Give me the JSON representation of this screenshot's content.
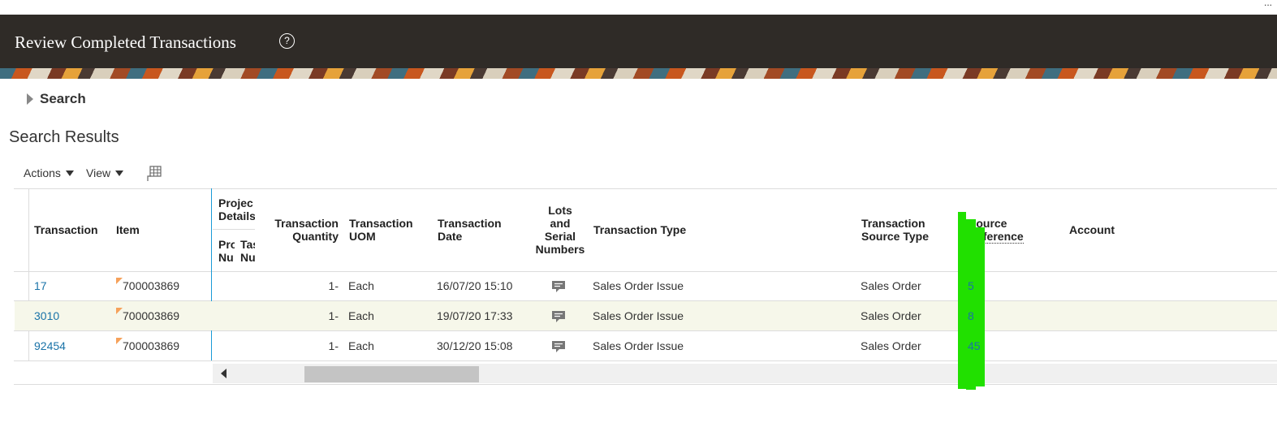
{
  "window": {
    "corner_text": "..."
  },
  "header": {
    "title": "Review Completed Transactions",
    "help_glyph": "?"
  },
  "search": {
    "label": "Search"
  },
  "results": {
    "title": "Search Results"
  },
  "toolbar": {
    "actions_label": "Actions",
    "view_label": "View",
    "detach_icon": "detach-table-icon"
  },
  "table": {
    "group_header": {
      "line1": "Projec",
      "line2": "Details"
    },
    "sub_headers": {
      "project_number": {
        "l1": "Pro",
        "l2": "Nu"
      },
      "task_number": {
        "l1": "Tas",
        "l2": "Nu"
      }
    },
    "headers": {
      "transaction": "Transaction",
      "item": "Item",
      "quantity": {
        "l1": "Transaction",
        "l2": "Quantity"
      },
      "uom": {
        "l1": "Transaction",
        "l2": "UOM"
      },
      "date": {
        "l1": "Transaction",
        "l2": "Date"
      },
      "lots": {
        "l1": "Lots",
        "l2": "and",
        "l3": "Serial",
        "l4": "Numbers"
      },
      "type": "Transaction Type",
      "source_type": {
        "l1": "Transaction",
        "l2": "Source Type"
      },
      "source_ref": {
        "l1": "Source",
        "l2": "Reference"
      },
      "account": "Account"
    },
    "rows": [
      {
        "transaction": "17",
        "item": "700003869",
        "quantity": "1-",
        "uom": "Each",
        "date": "16/07/20 15:10",
        "type": "Sales Order Issue",
        "source_type": "Sales Order",
        "source_ref": "5"
      },
      {
        "transaction": "3010",
        "item": "700003869",
        "quantity": "1-",
        "uom": "Each",
        "date": "19/07/20 17:33",
        "type": "Sales Order Issue",
        "source_type": "Sales Order",
        "source_ref": "8"
      },
      {
        "transaction": "92454",
        "item": "700003869",
        "quantity": "1-",
        "uom": "Each",
        "date": "30/12/20 15:08",
        "type": "Sales Order Issue",
        "source_type": "Sales Order",
        "source_ref": "45"
      }
    ]
  },
  "colors": {
    "header_bg": "#2f2b27",
    "link": "#1a73a8",
    "selected_row": "#f6f7ea",
    "highlight_mark": "#21e000"
  }
}
